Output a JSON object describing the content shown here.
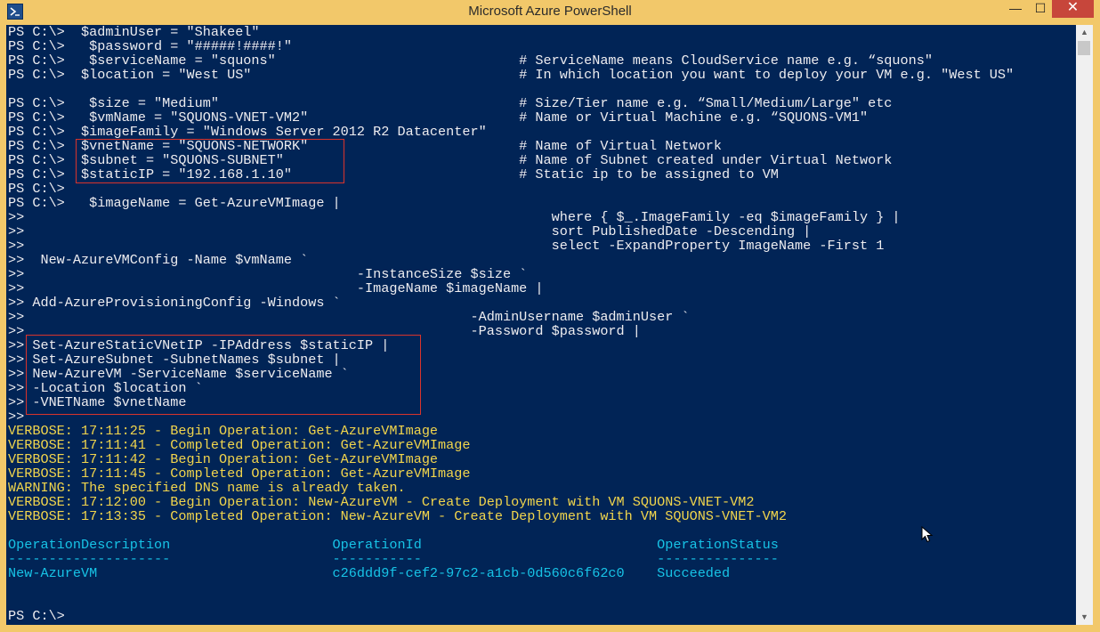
{
  "window": {
    "title": "Microsoft Azure PowerShell",
    "minimize_glyph": "—",
    "maximize_glyph": "☐",
    "close_glyph": "✕",
    "icon": "powershell-icon"
  },
  "colors": {
    "console_bg": "#012456",
    "text_white": "#eeedf0",
    "text_cyan": "#17c3e6",
    "text_yellow": "#f2d54c",
    "highlight_red": "#d9342b",
    "titlebar": "#f2c86a"
  },
  "console": {
    "lines": [
      {
        "text": "PS C:\\>  $adminUser = \"Shakeel\"",
        "color": "white"
      },
      {
        "text": "PS C:\\>   $password = \"#####!####!\"",
        "color": "white"
      },
      {
        "text": "PS C:\\>   $serviceName = \"squons\"                              # ServiceName means CloudService name e.g. “squons\"",
        "color": "white"
      },
      {
        "text": "PS C:\\>  $location = \"West US\"                                 # In which location you want to deploy your VM e.g. \"West US\"",
        "color": "white"
      },
      {
        "text": "",
        "color": "white"
      },
      {
        "text": "PS C:\\>   $size = \"Medium\"                                     # Size/Tier name e.g. “Small/Medium/Large\" etc",
        "color": "white"
      },
      {
        "text": "PS C:\\>   $vmName = \"SQUONS-VNET-VM2\"                          # Name or Virtual Machine e.g. “SQUONS-VM1\"",
        "color": "white"
      },
      {
        "text": "PS C:\\>  $imageFamily = \"Windows Server 2012 R2 Datacenter\"",
        "color": "white"
      },
      {
        "text": "PS C:\\>  $vnetName = \"SQUONS-NETWORK\"                          # Name of Virtual Network",
        "color": "white"
      },
      {
        "text": "PS C:\\>  $subnet = \"SQUONS-SUBNET\"                             # Name of Subnet created under Virtual Network",
        "color": "white"
      },
      {
        "text": "PS C:\\>  $staticIP = \"192.168.1.10\"                            # Static ip to be assigned to VM",
        "color": "white"
      },
      {
        "text": "PS C:\\>",
        "color": "white"
      },
      {
        "text": "PS C:\\>   $imageName = Get-AzureVMImage |",
        "color": "white"
      },
      {
        "text": ">>                                                                 where { $_.ImageFamily -eq $imageFamily } |",
        "color": "white"
      },
      {
        "text": ">>                                                                 sort PublishedDate -Descending |",
        "color": "white"
      },
      {
        "text": ">>                                                                 select -ExpandProperty ImageName -First 1",
        "color": "white"
      },
      {
        "text": ">>  New-AzureVMConfig -Name $vmName `",
        "color": "white"
      },
      {
        "text": ">>                                         -InstanceSize $size `",
        "color": "white"
      },
      {
        "text": ">>                                         -ImageName $imageName |",
        "color": "white"
      },
      {
        "text": ">> Add-AzureProvisioningConfig -Windows `",
        "color": "white"
      },
      {
        "text": ">>                                                       -AdminUsername $adminUser `",
        "color": "white"
      },
      {
        "text": ">>                                                       -Password $password |",
        "color": "white"
      },
      {
        "text": ">> Set-AzureStaticVNetIP -IPAddress $staticIP |",
        "color": "white"
      },
      {
        "text": ">> Set-AzureSubnet -SubnetNames $subnet |",
        "color": "white"
      },
      {
        "text": ">> New-AzureVM -ServiceName $serviceName `",
        "color": "white"
      },
      {
        "text": ">> -Location $location `",
        "color": "white"
      },
      {
        "text": ">> -VNETName $vnetName",
        "color": "white"
      },
      {
        "text": ">>",
        "color": "white"
      },
      {
        "text": "VERBOSE: 17:11:25 - Begin Operation: Get-AzureVMImage",
        "color": "yellow"
      },
      {
        "text": "VERBOSE: 17:11:41 - Completed Operation: Get-AzureVMImage",
        "color": "yellow"
      },
      {
        "text": "VERBOSE: 17:11:42 - Begin Operation: Get-AzureVMImage",
        "color": "yellow"
      },
      {
        "text": "VERBOSE: 17:11:45 - Completed Operation: Get-AzureVMImage",
        "color": "yellow"
      },
      {
        "text": "WARNING: The specified DNS name is already taken.",
        "color": "yellow"
      },
      {
        "text": "VERBOSE: 17:12:00 - Begin Operation: New-AzureVM - Create Deployment with VM SQUONS-VNET-VM2",
        "color": "yellow"
      },
      {
        "text": "VERBOSE: 17:13:35 - Completed Operation: New-AzureVM - Create Deployment with VM SQUONS-VNET-VM2",
        "color": "yellow"
      },
      {
        "text": "",
        "color": "white"
      },
      {
        "text": "OperationDescription                    OperationId                             OperationStatus",
        "color": "cyan"
      },
      {
        "text": "--------------------                    -----------                             ---------------",
        "color": "cyan"
      },
      {
        "text": "New-AzureVM                             c26ddd9f-cef2-97c2-a1cb-0d560c6f62c0    Succeeded",
        "color": "cyan"
      },
      {
        "text": "",
        "color": "white"
      },
      {
        "text": "",
        "color": "white"
      },
      {
        "text": "PS C:\\>",
        "color": "white"
      }
    ]
  },
  "scrollbar": {
    "up_glyph": "▲",
    "down_glyph": "▼"
  }
}
